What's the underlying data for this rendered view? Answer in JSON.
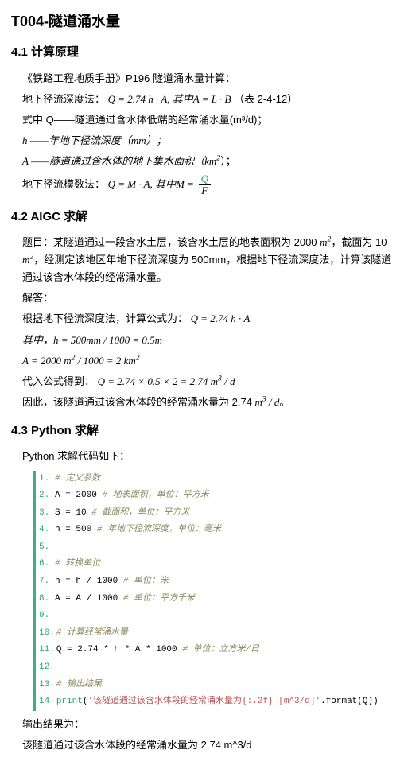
{
  "title": "T004-隧道涌水量",
  "s1": {
    "heading": "4.1 计算原理",
    "l1": "《铁路工程地质手册》P196 隧道涌水量计算：",
    "l2a": "地下径流深度法：",
    "l2b": "Q = 2.74 h · A, 其中A = L · B",
    "l2c": "（表 2-4-12）",
    "l3": "式中 Q——隧道通过含水体低端的经常涌水量(m³/d)；",
    "l4": "h ——年地下径流深度（mm）；",
    "l5a": "A ——隧道通过含水体的地下集水面积（",
    "l5b": "km²",
    "l5c": "）；",
    "l6a": "地下径流模数法：",
    "l6b": "Q = M · A, 其中M =",
    "frac_num": "Q",
    "frac_den": "F"
  },
  "s2": {
    "heading": "4.2 AIGC 求解",
    "p1": "题目：某隧道通过一段含水土层，该含水土层的地表面积为 2000 m²，截面为 10 m²，经测定该地区年地下径流深度为 500mm，根据地下径流深度法，计算该隧道通过该含水体段的经常涌水量。",
    "p2": "解答：",
    "p3a": "根据地下径流深度法，计算公式为：",
    "p3b": "Q = 2.74 h · A",
    "p4": "其中，h = 500mm / 1000 = 0.5m",
    "p5": "A = 2000 m² / 1000 = 2 km²",
    "p6a": "代入公式得到：",
    "p6b": "Q = 2.74 × 0.5 × 2 = 2.74 m³ / d",
    "p7a": "因此，该隧道通过该含水体段的经常涌水量为 2.74 ",
    "p7b": "m³ / d",
    "p7c": "。"
  },
  "s3": {
    "heading": "4.3 Python 求解",
    "intro": "Python 求解代码如下：",
    "code": [
      {
        "n": "1.",
        "t": "# 定义参数",
        "cls": "cmt"
      },
      {
        "n": "2.",
        "t": "A = 2000 # 地表面积，单位：平方米"
      },
      {
        "n": "3.",
        "t": "S = 10 # 截面积，单位：平方米"
      },
      {
        "n": "4.",
        "t": "h = 500 # 年地下径流深度，单位：毫米"
      },
      {
        "n": "5.",
        "t": ""
      },
      {
        "n": "6.",
        "t": "# 转换单位",
        "cls": "cmt"
      },
      {
        "n": "7.",
        "t": "h = h / 1000 # 单位：米"
      },
      {
        "n": "8.",
        "t": "A = A / 1000 # 单位：平方千米"
      },
      {
        "n": "9.",
        "t": ""
      },
      {
        "n": "10.",
        "t": "# 计算经常涌水量",
        "cls": "cmt"
      },
      {
        "n": "11.",
        "t": "Q = 2.74 * h * A * 1000 # 单位：立方米/日"
      },
      {
        "n": "12.",
        "t": ""
      },
      {
        "n": "13.",
        "t": "# 输出结果",
        "cls": "cmt"
      },
      {
        "n": "14.",
        "t": "print('该隧道通过该含水体段的经常涌水量为{:.2f} [m^3/d]'.format(Q))",
        "cls": "print"
      }
    ],
    "out1": "输出结果为：",
    "out2": "该隧道通过该含水体段的经常涌水量为 2.74 m^3/d"
  }
}
